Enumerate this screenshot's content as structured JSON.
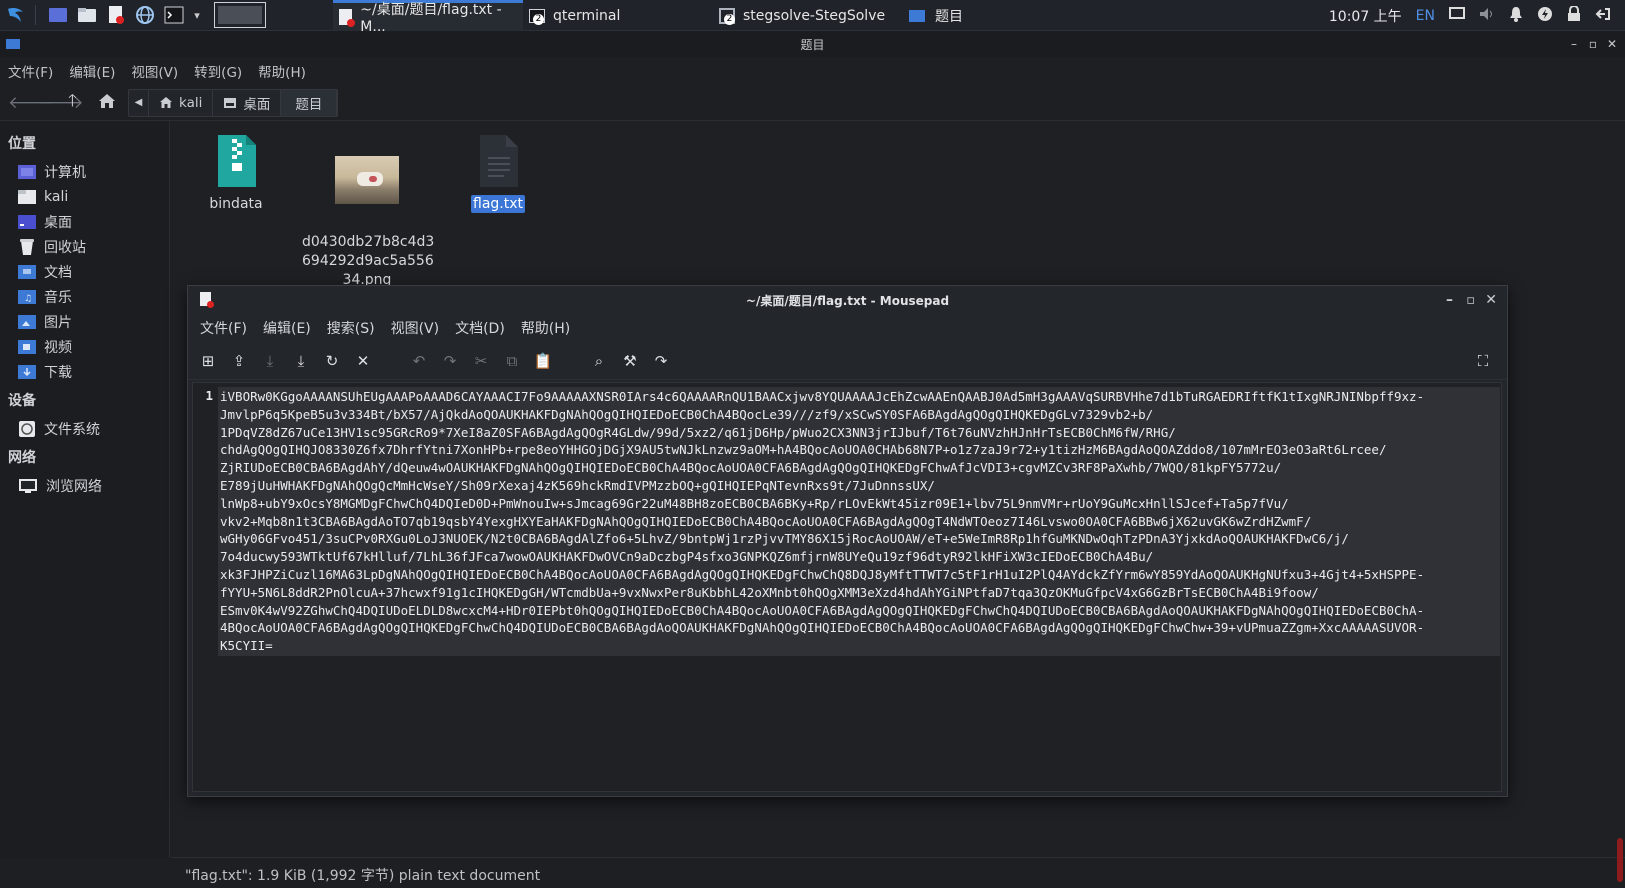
{
  "taskbar": {
    "tasks": [
      {
        "label": "~/桌面/题目/flag.txt - M..."
      },
      {
        "label": "qterminal",
        "badge": "2"
      },
      {
        "label": "stegsolve-StegSolve",
        "badge": "2"
      },
      {
        "label": "题目"
      }
    ],
    "clock": "10:07 上午",
    "lang": "EN"
  },
  "fm": {
    "title": "题目",
    "menu": [
      "文件(F)",
      "编辑(E)",
      "视图(V)",
      "转到(G)",
      "帮助(H)"
    ],
    "path": [
      "kali",
      "桌面",
      "题目"
    ],
    "sidebar": {
      "places_header": "位置",
      "places": [
        "计算机",
        "kali",
        "桌面",
        "回收站",
        "文档",
        "音乐",
        "图片",
        "视频",
        "下载"
      ],
      "devices_header": "设备",
      "devices": [
        "文件系统"
      ],
      "network_header": "网络",
      "network": [
        "浏览网络"
      ]
    },
    "files": [
      {
        "name": "bindata",
        "icon": "archive-icon"
      },
      {
        "name": "d0430db27b8c4d3\n694292d9ac5a556\n34.png",
        "icon": "image-thumbnail"
      },
      {
        "name": "flag.txt",
        "icon": "text-file-icon",
        "selected": true
      }
    ],
    "status": "\"flag.txt\": 1.9 KiB (1,992 字节) plain text document"
  },
  "mousepad": {
    "title": "~/桌面/题目/flag.txt - Mousepad",
    "menu": [
      "文件(F)",
      "编辑(E)",
      "搜索(S)",
      "视图(V)",
      "文档(D)",
      "帮助(H)"
    ],
    "line_number": "1",
    "content": "iVBORw0KGgoAAAANSUhEUgAAAPoAAAD6CAYAAACI7Fo9AAAAAXNSR0IArs4c6QAAAARnQU1BAACxjwv8YQUAAAAJcEhZcwAAEnQAABJ0Ad5mH3gAAAVqSURBVHhe7d1bTuRGAEDRIftfK1tIxgNRJNINbpff9xz-\nJmvlpP6q5KpeB5u3v334Bt/bX57/AjQkdAoQOAUKHAKFDgNAhQOgQIHQIEDoECB0ChA4BQocLe39///zf9/xSCwSY0SFA6BAgdAgQOgQIHQKEDgGLv7329vb2+b/\n1PDqVZ8dZ67uCe13HV1sc95GRcRo9*7XeI8aZ0SFA6BAgdAgQOgR4GLdw/99d/5xz2/q61jD6Hp/pWuo2CX3NN3jrIJbuf/T6t76uNVzhHJnHrTsECB0ChM6fW/RHG/\nchdAgQOgQIHQJO8330Z6fx7DhrfYtni7XonHPb+rpe8eoYHHGOjDGjX9AU5twNJkLnzwz9aOM+hA4BQocAoUOA0CHAb68N7P+o1z7zaJ9r72+y1tizHzM6BAgdAoQOAZddo8/107mMrEO3eO3aRt6Lrcee/\nZjRIUDoECB0CBA6BAgdAhY/dQeuw4wOAUKHAKFDgNAhQOgQIHQIEDoECB0ChA4BQocAoUOA0CFA6BAgdAgQOgQIHQKEDgFChwAfJcVDI3+cgvMZCv3RF8PaXwhb/7WQO/81kpFY5772u/\nE789jUuHWHAKFDgNAhQOgQcMmHcWseY/Sh09rXexaj4zK569hckRmdIVPMzzbOQ+gQIHQIEPqNTevnRxs9t/7JuDnnssUX/\nlnWp8+ubY9xOcsY8MGMDgFChwChQ4DQIeD0D+PmWnouIw+sJmcag69Gr22uM48BH8zoECB0CBA6BKy+Rp/rLOvEkWt45izr09E1+lbv75L9nmVMr+rUoY9GuMcxHnllSJcef+Ta5p7fVu/\nvkv2+Mqb8n1t3CBA6BAgdAoTO7qb19qsbY4YexgHXYEaHAKFDgNAhQOgQIHQIEDoECB0ChA4BQocAoUOA0CFA6BAgdAgQOgT4NdWTOeoz7I46Lvswo0OA0CFA6BBw6jX62uvGK6wZrdHZwmF/\nwGHy06GFvo451/3suCPv0RXGu0LoJ3NUOEK/N2t0CBA6BAgdAlZfo6+5LhvZ/9bntpWj1rzPjvvTMY86X15jRocAoUOAW/eT+e5WeImR8Rp1hfGuMKNDwOqhTzPDnA3YjxkdAoQOAUKHAKFDwC6/j/\n7o4ducwy593WTktUf67kHlluf/7LhL36fJFca7wowOAUKHAKFDwOVCn9aDczbgP4sfxo3GNPKQZ6mfjrnW8UYeQu19zf96dtyR92lkHFiXW3cIEDoECB0ChA4Bu/\nxk3FJHPZiCuzl16MA63LpDgNAhQOgQIHQIEDoECB0ChA4BQocAoUOA0CFA6BAgdAgQOgQIHQKEDgFChwChQ8DQJ8yMftTTWT7c5tF1rH1uI2PlQ4AYdckZfYrm6wY859YdAoQOAUKHgNUfxu3+4Gjt4+5xHSPPE-\nfYYU+5N6L8ddR2PnOlcuA+37hcwxf91g1cIHQKEDgGH/WTcmdbUa+9vxNwxPer8uKbbhL42oXMnbt0hQOgXMM3eXzd4hdAhYGiNPtfaD7tqa3QzOKMuGfpcV4xG6GzBrTsECB0ChA4Bi9foow/\nESmv0K4wV92ZGhwChQ4DQIUDoELDLD8wcxcM4+HDr0IEPbt0hQOgQIHQIEDoECB0ChA4BQocAoUOA0CFA6BAgdAgQOgQIHQKEDgFChwChQ4DQIUDoECB0CBA6BAgdAoQOAUKHAKFDgNAhQOgQIHQIEDoECB0ChA-\n4BQocAoUOA0CFA6BAgdAgQOgQIHQKEDgFChwChQ4DQIUDoECB0CBA6BAgdAoQOAUKHAKFDgNAhQOgQIHQIEDoECB0ChA4BQocAoUOA0CFA6BAgdAgQOgQIHQKEDgFChwChw+39+vUPmuaZZgm+XxcAAAAASUVOR-\nK5CYII="
  }
}
